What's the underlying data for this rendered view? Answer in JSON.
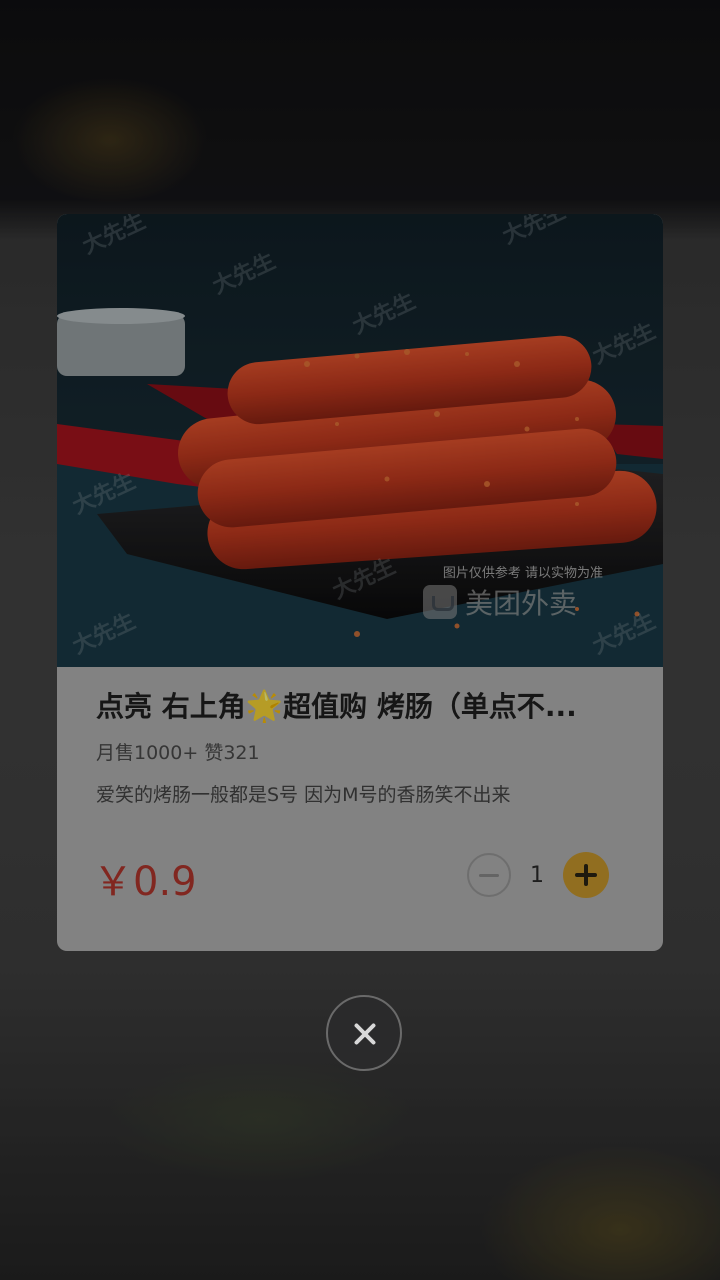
{
  "product": {
    "title_prefix": "点亮 右上角",
    "title_star": "🌟",
    "title_suffix": "超值购 烤肠（单点不...",
    "sales": "月售1000+ 赞321",
    "description": "爱笑的烤肠一般都是S号 因为M号的香肠笑不出来",
    "price": "￥0.9",
    "quantity": "1",
    "photo_caption": "图片仅供参考 请以实物为准",
    "photo_brand": "美团外卖",
    "photo_watermark": "大先生 MR.BIG"
  },
  "icons": {
    "minus": "minus-circle-icon",
    "plus": "plus-circle-icon",
    "close": "close-icon",
    "star": "star-icon"
  },
  "colors": {
    "price": "#b3362d",
    "plus_button": "#c9992d",
    "card": "#b4b4b4"
  }
}
